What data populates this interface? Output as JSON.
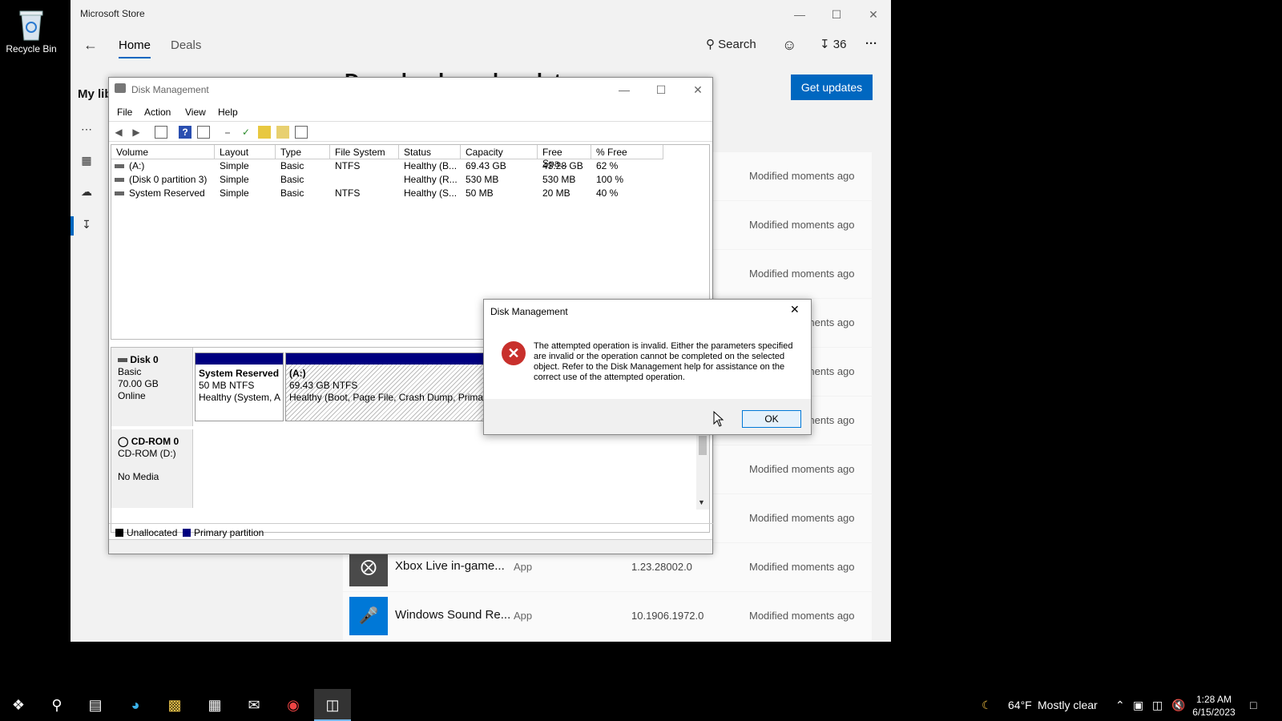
{
  "desktop": {
    "recycle_bin_label": "Recycle Bin"
  },
  "store": {
    "title": "Microsoft Store",
    "nav": {
      "home": "Home",
      "deals": "Deals",
      "search": "Search",
      "downloads_count": "36",
      "more": "···"
    },
    "sidebar_heading_partial": "My lib",
    "page_title_partial": "Downloads and updates",
    "get_updates_label": "Get updates",
    "modified_text": "Modified moments ago",
    "rows": [
      {
        "name": "Xbox Live in-game...",
        "type": "App",
        "version": "1.23.28002.0",
        "modified": "Modified moments ago",
        "logo_color": "#4a4a4a"
      },
      {
        "name": "Windows Sound Re...",
        "type": "App",
        "version": "10.1906.1972.0",
        "modified": "Modified moments ago",
        "logo_color": "#0078d7"
      }
    ]
  },
  "disk_mgmt": {
    "title": "Disk Management",
    "menu": [
      "File",
      "Action",
      "View",
      "Help"
    ],
    "columns": [
      "Volume",
      "Layout",
      "Type",
      "File System",
      "Status",
      "Capacity",
      "Free Spa...",
      "% Free"
    ],
    "volumes": [
      [
        "(A:)",
        "Simple",
        "Basic",
        "NTFS",
        "Healthy (B...",
        "69.43 GB",
        "43.28 GB",
        "62 %"
      ],
      [
        "(Disk 0 partition 3)",
        "Simple",
        "Basic",
        "",
        "Healthy (R...",
        "530 MB",
        "530 MB",
        "100 %"
      ],
      [
        "System Reserved",
        "Simple",
        "Basic",
        "NTFS",
        "Healthy (S...",
        "50 MB",
        "20 MB",
        "40 %"
      ]
    ],
    "disk0": {
      "name": "Disk 0",
      "type": "Basic",
      "size": "70.00 GB",
      "state": "Online"
    },
    "partitions": [
      {
        "name": "System Reserved",
        "size": "50 MB NTFS",
        "status": "Healthy (System, A"
      },
      {
        "name": "(A:)",
        "size": "69.43 GB NTFS",
        "status": "Healthy (Boot, Page File, Crash Dump, Primar"
      }
    ],
    "cdrom": {
      "name": "CD-ROM 0",
      "drive": "CD-ROM (D:)",
      "media": "No Media"
    },
    "legend": {
      "unallocated": "Unallocated",
      "primary": "Primary partition",
      "unallocated_color": "#000000",
      "primary_color": "#000080"
    }
  },
  "error_dialog": {
    "title": "Disk Management",
    "message": "The attempted operation is invalid.  Either the parameters specified are invalid or the operation cannot be completed on the selected object.  Refer to the Disk Management help for assistance on the correct use of the attempted operation.",
    "ok_label": "OK"
  },
  "taskbar": {
    "weather_temp": "64°F",
    "weather_text": "Mostly clear",
    "time": "1:28 AM",
    "date": "6/15/2023"
  }
}
